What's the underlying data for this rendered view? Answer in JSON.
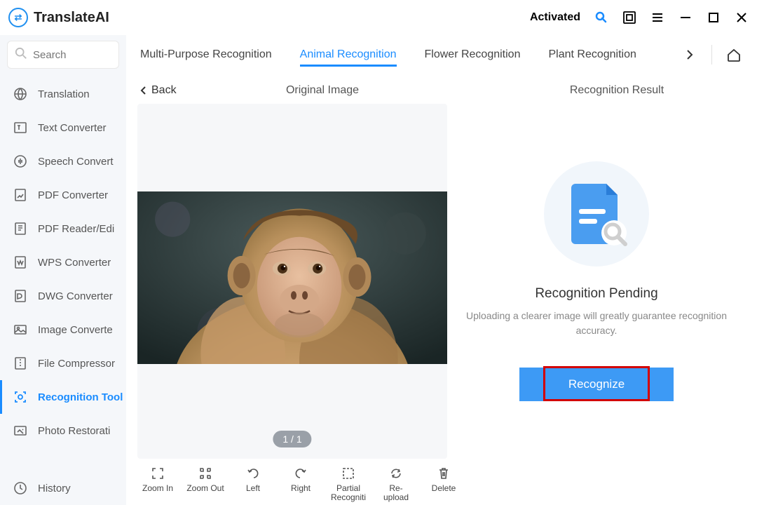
{
  "app": {
    "name": "TranslateAI",
    "activated": "Activated"
  },
  "search": {
    "placeholder": "Search"
  },
  "sidebar": {
    "items": [
      {
        "label": "Translation"
      },
      {
        "label": "Text Converter"
      },
      {
        "label": "Speech Convert"
      },
      {
        "label": "PDF Converter"
      },
      {
        "label": "PDF Reader/Edi"
      },
      {
        "label": "WPS Converter"
      },
      {
        "label": "DWG Converter"
      },
      {
        "label": "Image Converte"
      },
      {
        "label": "File Compressor"
      },
      {
        "label": "Recognition Tool"
      },
      {
        "label": "Photo Restorati"
      }
    ],
    "history": "History"
  },
  "tabs": [
    {
      "label": "Multi-Purpose Recognition"
    },
    {
      "label": "Animal Recognition"
    },
    {
      "label": "Flower Recognition"
    },
    {
      "label": "Plant Recognition"
    }
  ],
  "back": "Back",
  "headers": {
    "original": "Original Image",
    "result": "Recognition Result"
  },
  "image": {
    "page": "1 / 1"
  },
  "result": {
    "title": "Recognition Pending",
    "desc": "Uploading a clearer image will greatly guarantee recognition accuracy.",
    "button": "Recognize"
  },
  "toolbar": [
    {
      "label": "Zoom In"
    },
    {
      "label": "Zoom Out"
    },
    {
      "label": "Left"
    },
    {
      "label": "Right"
    },
    {
      "label": "Partial Recogniti"
    },
    {
      "label": "Re-upload"
    },
    {
      "label": "Delete"
    }
  ]
}
